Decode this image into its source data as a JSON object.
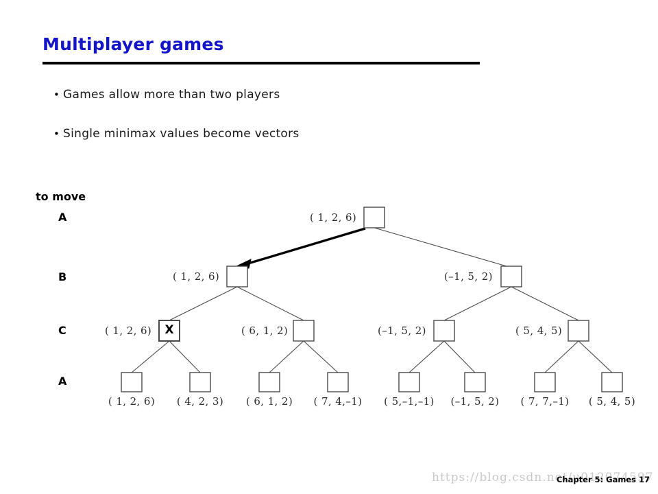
{
  "slide": {
    "title": "Multiplayer games",
    "bullet_marker": "•",
    "bullets": [
      "Games allow more than two players",
      "Single minimax values become vectors"
    ],
    "footer": "Chapter 5: Games 17",
    "watermark": "https://blog.csdn.net/u012074597",
    "title_color": "#1414c8",
    "rule_color": "#000000"
  },
  "figure": {
    "to_move_caption": "to move",
    "row_labels": [
      "A",
      "B",
      "C",
      "A"
    ],
    "highlighted_node_mark": "X",
    "nodes": {
      "root": {
        "label": "( 1, 2, 6)"
      },
      "b_level": [
        {
          "label": "( 1, 2, 6)"
        },
        {
          "label": "(–1, 5, 2)"
        }
      ],
      "c_level": [
        {
          "label": "( 1, 2, 6)",
          "mark": "X"
        },
        {
          "label": "( 6, 1, 2)",
          "mark": ""
        },
        {
          "label": "(–1, 5, 2)",
          "mark": ""
        },
        {
          "label": "( 5, 4, 5)",
          "mark": ""
        }
      ],
      "leaves": [
        {
          "label": "( 1, 2, 6)"
        },
        {
          "label": "( 4, 2, 3)"
        },
        {
          "label": "( 6, 1, 2)"
        },
        {
          "label": "( 7, 4,–1)"
        },
        {
          "label": "( 5,–1,–1)"
        },
        {
          "label": "(–1, 5, 2)"
        },
        {
          "label": "( 7, 7,–1)"
        },
        {
          "label": "( 5, 4, 5)"
        }
      ]
    },
    "best_move_arrow": "root-to-left-b",
    "edge_color": "#4a4a4a",
    "box_color": "#4a4a4a"
  }
}
